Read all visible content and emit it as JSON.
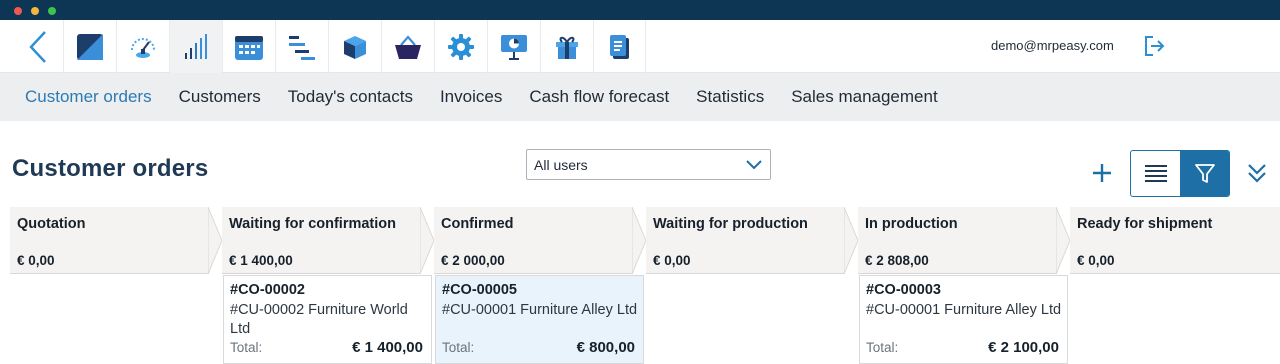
{
  "window": {
    "dots": [
      "#ee5a52",
      "#f2b73b",
      "#3fc34c"
    ]
  },
  "topnav": {
    "modules": [
      {
        "icon": "dashboard-tile-icon"
      },
      {
        "icon": "speedometer-icon"
      },
      {
        "icon": "signal-bars-icon",
        "active": true
      },
      {
        "icon": "calendar-icon"
      },
      {
        "icon": "gantt-icon"
      },
      {
        "icon": "box-icon"
      },
      {
        "icon": "basket-icon"
      },
      {
        "icon": "gear-icon"
      },
      {
        "icon": "presentation-icon"
      },
      {
        "icon": "gift-icon"
      },
      {
        "icon": "documents-icon"
      }
    ],
    "user": "demo@mrpeasy.com"
  },
  "subnav": {
    "items": [
      "Customer orders",
      "Customers",
      "Today's contacts",
      "Invoices",
      "Cash flow forecast",
      "Statistics",
      "Sales management"
    ],
    "active": 0
  },
  "page": {
    "title": "Customer orders",
    "user_filter": "All users"
  },
  "stages": [
    {
      "name": "Quotation",
      "total": "€ 0,00"
    },
    {
      "name": "Waiting for confirmation",
      "total": "€ 1 400,00"
    },
    {
      "name": "Confirmed",
      "total": "€ 2 000,00"
    },
    {
      "name": "Waiting for production",
      "total": "€ 0,00"
    },
    {
      "name": "In production",
      "total": "€ 2 808,00"
    },
    {
      "name": "Ready for shipment",
      "total": "€ 0,00"
    }
  ],
  "cards": [
    {
      "stage": 1,
      "id": "#CO-00002",
      "customer": "#CU-00002 Furniture World Ltd",
      "total_label": "Total:",
      "total": "€ 1 400,00",
      "highlight": false
    },
    {
      "stage": 2,
      "id": "#CO-00005",
      "customer": "#CU-00001 Furniture Alley Ltd",
      "total_label": "Total:",
      "total": "€ 800,00",
      "highlight": true
    },
    {
      "stage": 4,
      "id": "#CO-00003",
      "customer": "#CU-00001 Furniture Alley Ltd",
      "total_label": "Total:",
      "total": "€ 2 100,00",
      "highlight": false
    }
  ],
  "colors": {
    "accent": "#1e6fa5",
    "navy": "#0d3655",
    "active_link": "#2b7bb4"
  }
}
